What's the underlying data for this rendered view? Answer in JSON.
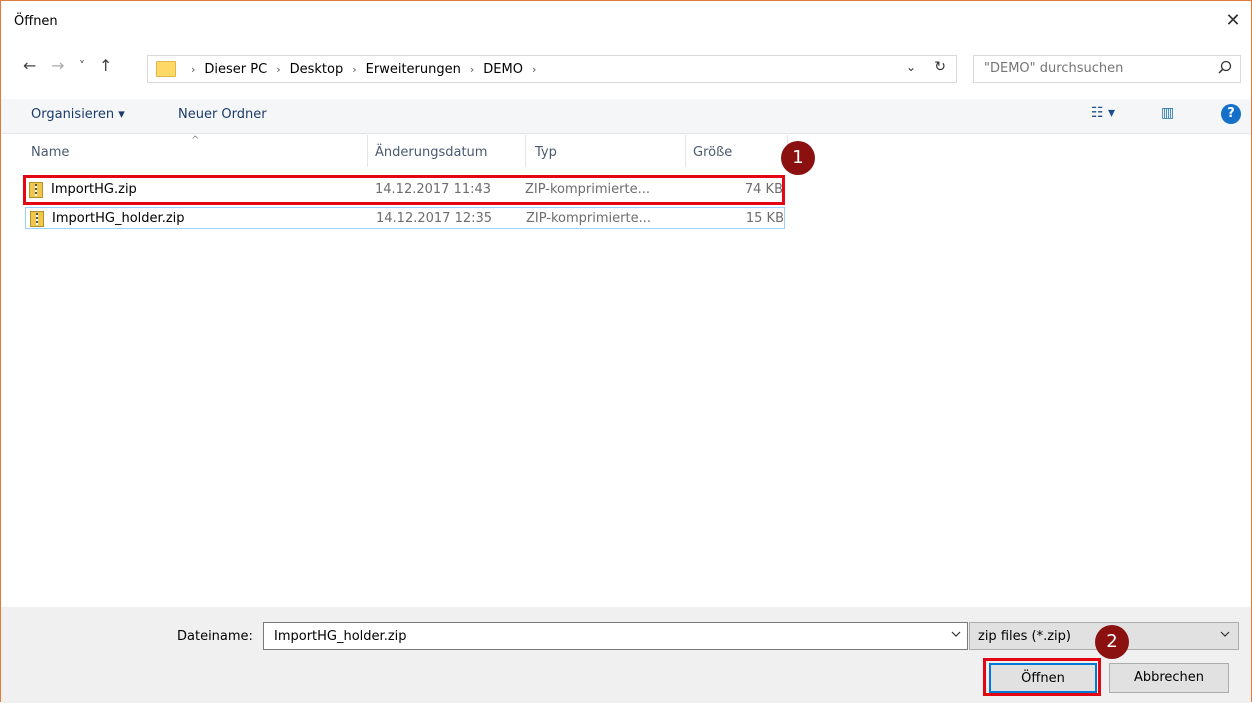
{
  "window": {
    "title": "Öffnen",
    "close_glyph": "✕"
  },
  "nav": {
    "back_glyph": "←",
    "forward_glyph": "→",
    "recent_glyph": "˅",
    "up_glyph": "↑",
    "breadcrumbs": [
      "Dieser PC",
      "Desktop",
      "Erweiterungen",
      "DEMO"
    ],
    "separator": "›",
    "dropdown_glyph": "⌄",
    "refresh_glyph": "↻"
  },
  "search": {
    "placeholder": "\"DEMO\" durchsuchen",
    "icon": "search-icon"
  },
  "toolbar": {
    "organize_label": "Organisieren ▾",
    "new_folder_label": "Neuer Ordner",
    "view_glyph": "☷ ▾",
    "pane_glyph": "▥",
    "help_glyph": "?"
  },
  "columns": {
    "name": "Name",
    "date": "Änderungsdatum",
    "type": "Typ",
    "size": "Größe",
    "sort_glyph": "^"
  },
  "files": [
    {
      "name": "ImportHG.zip",
      "date": "14.12.2017 11:43",
      "type": "ZIP-komprimierte...",
      "size": "74 KB"
    },
    {
      "name": "ImportHG_holder.zip",
      "date": "14.12.2017 12:35",
      "type": "ZIP-komprimierte...",
      "size": "15 KB"
    }
  ],
  "annotations": {
    "badge1": "1",
    "badge2": "2",
    "highlight_color": "#e30613",
    "badge_color": "#8b1010"
  },
  "bottom": {
    "filename_label": "Dateiname:",
    "filename_value": "ImportHG_holder.zip",
    "filetype_value": "zip files (*.zip)",
    "open_label": "Öffnen",
    "cancel_label": "Abbrechen"
  }
}
